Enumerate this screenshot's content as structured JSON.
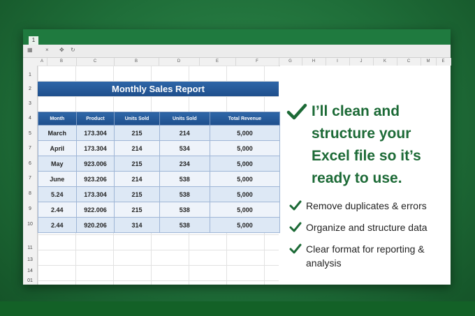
{
  "window": {
    "tab_number": "1"
  },
  "column_headers": [
    "A",
    "B",
    "C",
    "B",
    "D",
    "E",
    "F",
    "G",
    "H",
    "I",
    "J",
    "K",
    "C",
    "M",
    "E"
  ],
  "row_numbers": [
    "1",
    "2",
    "3",
    "4",
    "5",
    "7",
    "6",
    "7",
    "8",
    "9",
    "10",
    "11",
    "13",
    "14",
    "01"
  ],
  "report": {
    "title": "Monthly Sales Report",
    "columns": [
      "Month",
      "Product",
      "Units Sold",
      "Units Sold",
      "Total Revenue"
    ],
    "rows": [
      [
        "March",
        "173.304",
        "215",
        "214",
        "5,000"
      ],
      [
        "April",
        "173.304",
        "214",
        "534",
        "5,000"
      ],
      [
        "May",
        "923.006",
        "215",
        "234",
        "5,000"
      ],
      [
        "June",
        "923.206",
        "214",
        "538",
        "5,000"
      ],
      [
        "5.24",
        "173.304",
        "215",
        "538",
        "5,000"
      ],
      [
        "2.44",
        "922.006",
        "215",
        "538",
        "5,000"
      ],
      [
        "2.44",
        "920.206",
        "314",
        "538",
        "5,000"
      ]
    ]
  },
  "promo": {
    "headline": "I’ll clean and structure your Excel file so it’s ready to use.",
    "bullets": [
      "Remove duplicates & errors",
      "Organize and structure data",
      "Clear format for reporting & analysis"
    ]
  },
  "colors": {
    "brand_green": "#1c6a36",
    "header_blue": "#1f4f8c",
    "background_green": "#1f6e39"
  }
}
